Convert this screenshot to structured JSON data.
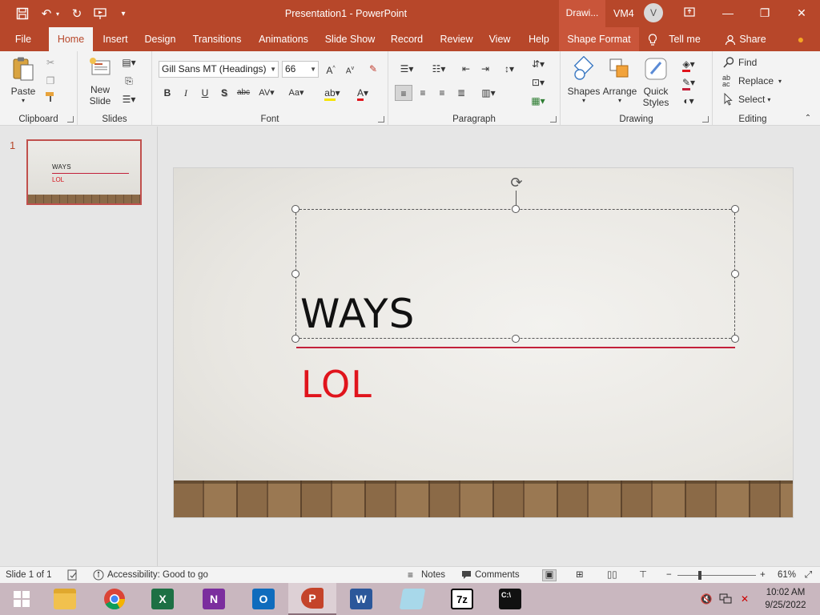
{
  "window": {
    "title": "Presentation1  -  PowerPoint",
    "context_label": "Drawi...",
    "user_name": "VM4",
    "avatar_letter": "V"
  },
  "tabs": [
    "File",
    "Home",
    "Insert",
    "Design",
    "Transitions",
    "Animations",
    "Slide Show",
    "Record",
    "Review",
    "View",
    "Help",
    "Shape Format"
  ],
  "tell_me": "Tell me",
  "share": "Share",
  "ribbon": {
    "clipboard": {
      "label": "Clipboard",
      "paste": "Paste"
    },
    "slides": {
      "label": "Slides",
      "new_slide_1": "New",
      "new_slide_2": "Slide"
    },
    "font": {
      "label": "Font",
      "font_name": "Gill Sans MT (Headings)",
      "font_size": "66"
    },
    "paragraph": {
      "label": "Paragraph"
    },
    "drawing": {
      "label": "Drawing",
      "shapes": "Shapes",
      "arrange": "Arrange",
      "quick_1": "Quick",
      "quick_2": "Styles"
    },
    "editing": {
      "label": "Editing",
      "find": "Find",
      "replace": "Replace",
      "select": "Select"
    }
  },
  "slide_pane": {
    "slide_number": "1",
    "thumb_title": "WAYS",
    "thumb_subtitle": "LOL"
  },
  "slide": {
    "title": "WAYS",
    "subtitle": "LOL"
  },
  "status": {
    "slide_info": "Slide 1 of 1",
    "accessibility": "Accessibility: Good to go",
    "notes": "Notes",
    "comments": "Comments",
    "zoom": "61%",
    "zoom_fraction": 0.61
  },
  "clock": {
    "time": "10:02 AM",
    "date": "9/25/2022"
  },
  "colors": {
    "accent": "#b7472a",
    "title_red": "#e0141c",
    "underline": "#c3203a"
  }
}
